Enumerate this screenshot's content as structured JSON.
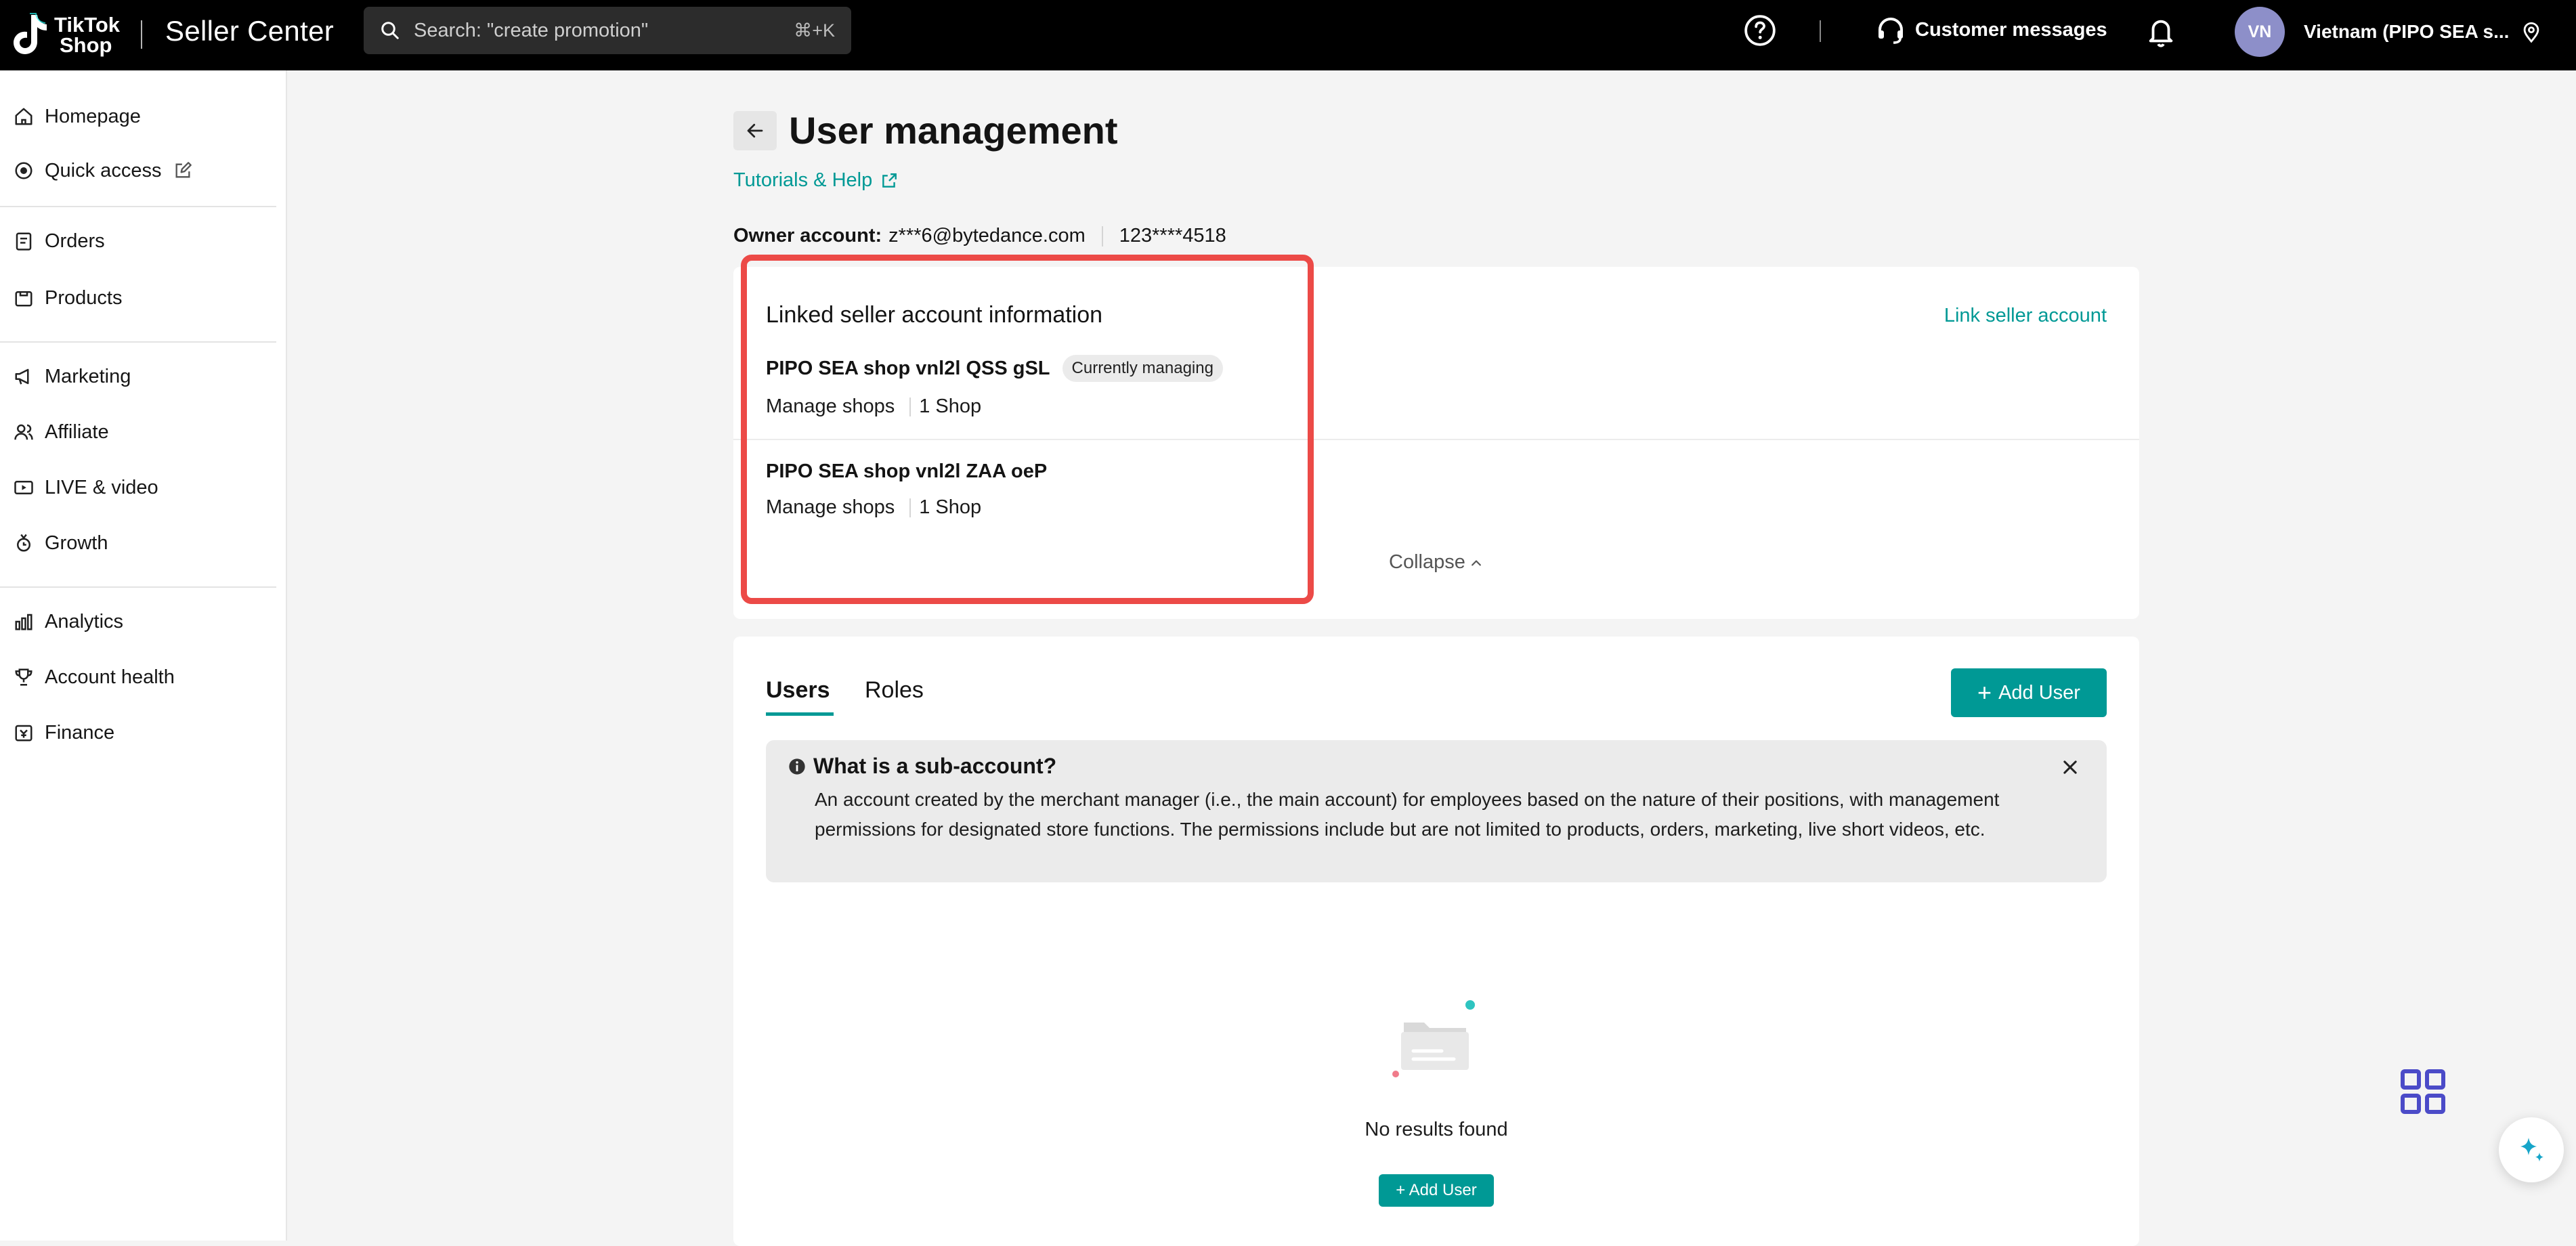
{
  "topbar": {
    "logo_line1": "TikTok",
    "logo_line2": "Shop",
    "app_title": "Seller Center",
    "search_placeholder": "Search: \"create promotion\"",
    "search_shortcut": "⌘+K",
    "customer_messages": "Customer messages",
    "avatar_initials": "VN",
    "account_label": "Vietnam  (PIPO SEA s..."
  },
  "sidebar": {
    "items": [
      {
        "label": "Homepage",
        "icon": "home-icon"
      },
      {
        "label": "Quick access",
        "icon": "quick-access-icon"
      },
      {
        "label": "Orders",
        "icon": "orders-icon"
      },
      {
        "label": "Products",
        "icon": "products-icon"
      },
      {
        "label": "Marketing",
        "icon": "megaphone-icon"
      },
      {
        "label": "Affiliate",
        "icon": "affiliate-icon"
      },
      {
        "label": "LIVE & video",
        "icon": "live-video-icon"
      },
      {
        "label": "Growth",
        "icon": "growth-icon"
      },
      {
        "label": "Analytics",
        "icon": "analytics-icon"
      },
      {
        "label": "Account health",
        "icon": "trophy-icon"
      },
      {
        "label": "Finance",
        "icon": "finance-icon"
      }
    ]
  },
  "page": {
    "title": "User management",
    "tutorials": "Tutorials & Help",
    "owner_label": "Owner account:",
    "owner_email": "z***6@bytedance.com",
    "owner_phone": "123****4518"
  },
  "linked": {
    "header": "Linked seller account information",
    "link_action": "Link seller account",
    "shops": [
      {
        "name": "PIPO SEA shop vnl2l QSS gSL",
        "badge": "Currently managing",
        "manage": "Manage shops",
        "count": "1 Shop"
      },
      {
        "name": "PIPO SEA shop vnl2l ZAA oeP",
        "manage": "Manage shops",
        "count": "1 Shop"
      }
    ],
    "collapse": "Collapse"
  },
  "users": {
    "tabs": [
      "Users",
      "Roles"
    ],
    "add_user": "Add User",
    "info_title": "What is a sub-account?",
    "info_body": "An account created by the merchant manager (i.e., the main account) for employees based on the nature of their positions, with management permissions for designated store functions. The permissions include but are not limited to products, orders, marketing, live short videos, etc.",
    "empty_text": "No results found",
    "add_user_small": "+ Add User"
  },
  "colors": {
    "accent": "#009995",
    "highlight": "#ec4a47",
    "avatar": "#8d8fc9",
    "floating_grid": "#4b4bc8"
  }
}
